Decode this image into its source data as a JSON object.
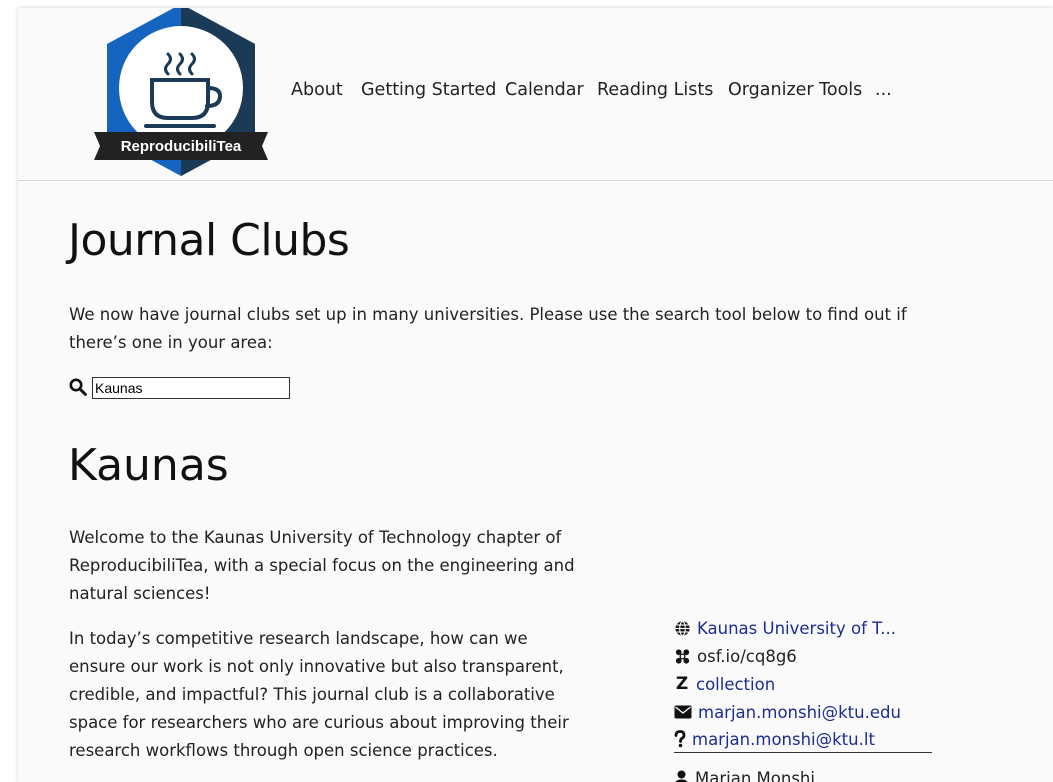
{
  "brand": {
    "logo_text": "ReproducibiliTea",
    "colors": {
      "hex_dark": "#1b3a57",
      "hex_blue": "#1565c0",
      "ribbon": "#222222"
    }
  },
  "nav": {
    "items": [
      "About",
      "Getting Started",
      "Calendar",
      "Reading Lists",
      "Organizer Tools",
      "..."
    ]
  },
  "page": {
    "title": "Journal Clubs",
    "intro": "We now have journal clubs set up in many universities. Please use the search tool below to find out if there’s one in your area:"
  },
  "search": {
    "value": "Kaunas",
    "icon": "search-icon"
  },
  "club": {
    "name": "Kaunas",
    "paragraphs": [
      "Welcome to the Kaunas University of Technology chapter of ReproducibiliTea, with a special focus on the engineering and natural sciences!",
      "In today’s competitive research landscape, how can we ensure our work is not only innovative but also transparent, credible, and impactful? This journal club is a collaborative space for researchers who are curious about improving their research workflows through open science practices."
    ],
    "links": {
      "website": "Kaunas University of T...",
      "osf": "osf.io/cq8g6",
      "zotero_prefix": "Z",
      "zotero": "collection",
      "email": "marjan.monshi@ktu.edu",
      "help": "marjan.monshi@ktu.lt",
      "organizer": "Marjan Monshi"
    },
    "link_color": "#1c2d8f"
  }
}
